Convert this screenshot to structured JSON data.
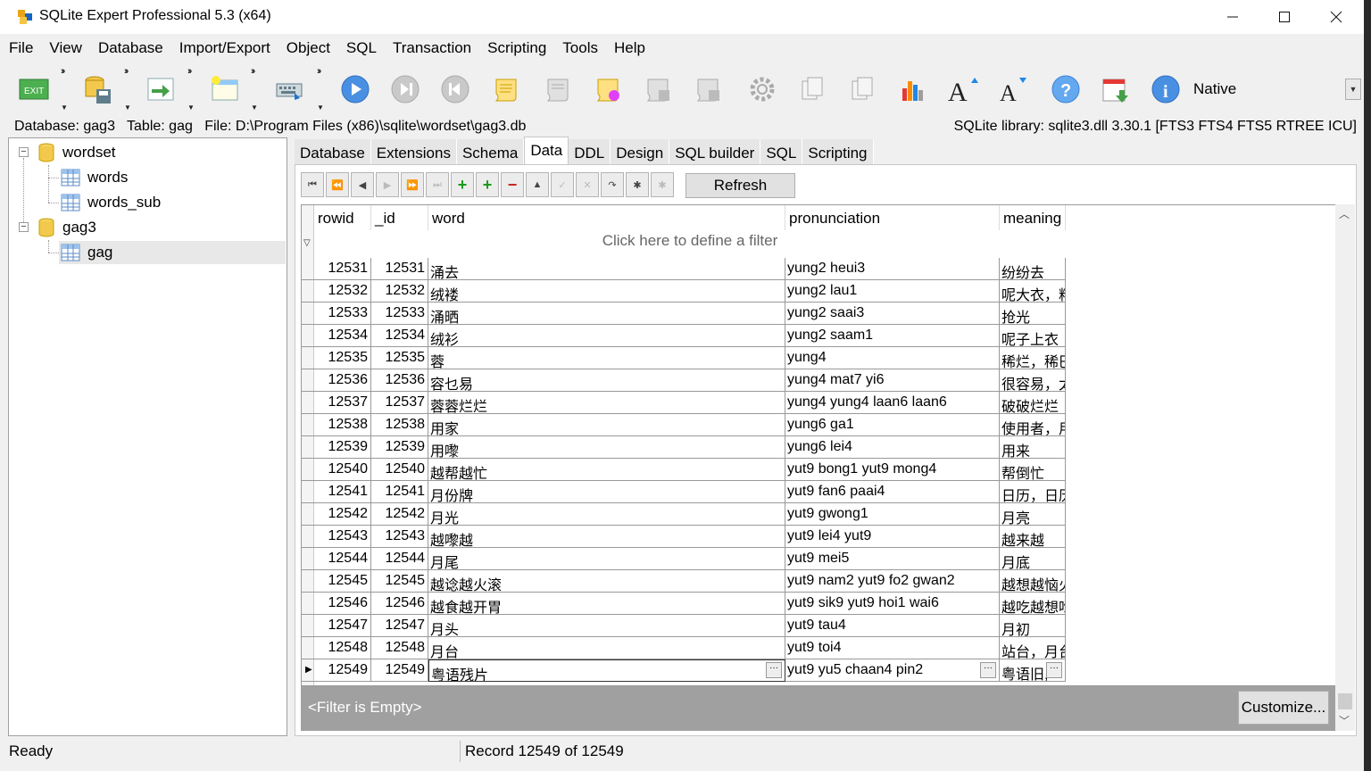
{
  "window": {
    "title": "SQLite Expert Professional 5.3 (x64)",
    "minimize": "—",
    "maximize": "☐",
    "close": "✕"
  },
  "menu": [
    "File",
    "View",
    "Database",
    "Import/Export",
    "Object",
    "SQL",
    "Transaction",
    "Scripting",
    "Tools",
    "Help"
  ],
  "toolbar": {
    "mode_label": "Native",
    "icons": [
      "exit-icon",
      "save-database-icon",
      "import-icon",
      "new-table-icon",
      "keyboard-icon",
      "play-icon",
      "stop-icon",
      "rewind-icon",
      "sql-scroll-icon",
      "sql-scroll-disabled-icon",
      "sql-open-icon",
      "sql-save-icon",
      "sql-save-as-icon",
      "settings-icon",
      "copy-icon",
      "paste-icon",
      "chart-icon",
      "increase-font-icon",
      "decrease-font-icon",
      "help-icon",
      "download-icon",
      "info-icon"
    ]
  },
  "infobar": {
    "database_label": "Database: gag3",
    "table_label": "Table: gag",
    "file_label": "File: D:\\Program Files (x86)\\sqlite\\wordset\\gag3.db",
    "library": "SQLite library: sqlite3.dll 3.30.1 [FTS3 FTS4 FTS5 RTREE ICU]"
  },
  "tree": {
    "nodes": [
      {
        "label": "wordset",
        "type": "database"
      },
      {
        "label": "words",
        "type": "table"
      },
      {
        "label": "words_sub",
        "type": "table"
      },
      {
        "label": "gag3",
        "type": "database"
      },
      {
        "label": "gag",
        "type": "table",
        "selected": true
      }
    ]
  },
  "tabs": [
    "Database",
    "Extensions",
    "Schema",
    "Data",
    "DDL",
    "Design",
    "SQL builder",
    "SQL",
    "Scripting"
  ],
  "active_tab": "Data",
  "nav": {
    "refresh_label": "Refresh",
    "buttons": [
      {
        "name": "first-record-button",
        "glyph": "⏮",
        "style": ""
      },
      {
        "name": "prior-page-button",
        "glyph": "⏪",
        "style": ""
      },
      {
        "name": "prior-record-button",
        "glyph": "◀",
        "style": ""
      },
      {
        "name": "next-record-button",
        "glyph": "▶",
        "style": "disabled"
      },
      {
        "name": "next-page-button",
        "glyph": "⏩",
        "style": "disabled"
      },
      {
        "name": "last-record-button",
        "glyph": "⏭",
        "style": "disabled"
      },
      {
        "name": "insert-record-button",
        "glyph": "+",
        "style": "green"
      },
      {
        "name": "append-record-button",
        "glyph": "+",
        "style": "green"
      },
      {
        "name": "delete-record-button",
        "glyph": "−",
        "style": "red"
      },
      {
        "name": "edit-record-button",
        "glyph": "▲",
        "style": ""
      },
      {
        "name": "post-edit-button",
        "glyph": "✓",
        "style": "disabled"
      },
      {
        "name": "cancel-edit-button",
        "glyph": "✕",
        "style": "disabled"
      },
      {
        "name": "refresh-data-button",
        "glyph": "↷",
        "style": ""
      },
      {
        "name": "set-bookmark-button",
        "glyph": "✱",
        "style": ""
      },
      {
        "name": "goto-bookmark-button",
        "glyph": "✱",
        "style": "disabled"
      }
    ]
  },
  "grid": {
    "columns": [
      "rowid",
      "_id",
      "word",
      "pronunciation",
      "meaning"
    ],
    "filter_placeholder": "Click here to define a filter",
    "rows": [
      [
        "12531",
        "12531",
        "涌去",
        "yung2 heui3",
        "纷纷去"
      ],
      [
        "12532",
        "12532",
        "绒褛",
        "yung2 lau1",
        "呢大衣，料"
      ],
      [
        "12533",
        "12533",
        "涌晒",
        "yung2 saai3",
        "抢光"
      ],
      [
        "12534",
        "12534",
        "绒衫",
        "yung2 saam1",
        "呢子上衣"
      ],
      [
        "12535",
        "12535",
        "蓉",
        "yung4",
        "稀烂，稀巴"
      ],
      [
        "12536",
        "12536",
        "容乜易",
        "yung4 mat7 yi6",
        "很容易，太"
      ],
      [
        "12537",
        "12537",
        "蓉蓉烂烂",
        "yung4 yung4 laan6 laan6",
        "破破烂烂"
      ],
      [
        "12538",
        "12538",
        "用家",
        "yung6 ga1",
        "使用者，用"
      ],
      [
        "12539",
        "12539",
        "用嚟",
        "yung6 lei4",
        "用来"
      ],
      [
        "12540",
        "12540",
        "越帮越忙",
        "yut9 bong1 yut9 mong4",
        "帮倒忙"
      ],
      [
        "12541",
        "12541",
        "月份牌",
        "yut9 fan6 paai4",
        "日历，日历"
      ],
      [
        "12542",
        "12542",
        "月光",
        "yut9 gwong1",
        "月亮"
      ],
      [
        "12543",
        "12543",
        "越嚟越",
        "yut9 lei4 yut9",
        "越来越"
      ],
      [
        "12544",
        "12544",
        "月尾",
        "yut9 mei5",
        "月底"
      ],
      [
        "12545",
        "12545",
        "越谂越火滚",
        "yut9 nam2 yut9 fo2 gwan2",
        "越想越恼火"
      ],
      [
        "12546",
        "12546",
        "越食越开胃",
        "yut9 sik9 yut9 hoi1 wai6",
        "越吃越想吃"
      ],
      [
        "12547",
        "12547",
        "月头",
        "yut9 tau4",
        "月初"
      ],
      [
        "12548",
        "12548",
        "月台",
        "yut9 toi4",
        "站台，月台"
      ],
      [
        "12549",
        "12549",
        "粤语残片",
        "yut9 yu5 chaan4 pin2",
        "粤语旧,"
      ]
    ],
    "filter_status": "<Filter is Empty>",
    "customize_label": "Customize..."
  },
  "status": {
    "state": "Ready",
    "record": "Record 12549 of 12549"
  }
}
